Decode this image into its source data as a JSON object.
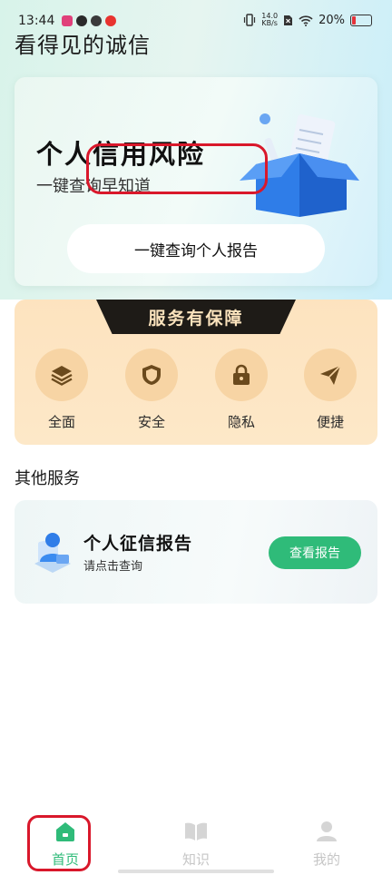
{
  "status_bar": {
    "time": "13:44",
    "net_speed_value": "14.0",
    "net_speed_unit": "KB/s",
    "battery": "20%"
  },
  "app": {
    "title": "看得见的诚信"
  },
  "hero": {
    "title": "个人信用风险",
    "subtitle": "一键查询早知道",
    "button_label": "一键查询个人报告"
  },
  "guarantee": {
    "title": "服务有保障",
    "features": [
      {
        "label": "全面",
        "icon": "layers-icon"
      },
      {
        "label": "安全",
        "icon": "shield-icon"
      },
      {
        "label": "隐私",
        "icon": "lock-icon"
      },
      {
        "label": "便捷",
        "icon": "send-icon"
      }
    ]
  },
  "other_services": {
    "title": "其他服务",
    "items": [
      {
        "title": "个人征信报告",
        "subtitle": "请点击查询",
        "button_label": "查看报告"
      }
    ]
  },
  "tabbar": {
    "tabs": [
      {
        "label": "首页",
        "active": true
      },
      {
        "label": "知识",
        "active": false
      },
      {
        "label": "我的",
        "active": false
      }
    ]
  },
  "colors": {
    "accent_green": "#2fbb79",
    "annotation_red": "#d9182b",
    "guarantee_bg": "#fde3bf",
    "icon_brown": "#6b4a1d"
  }
}
